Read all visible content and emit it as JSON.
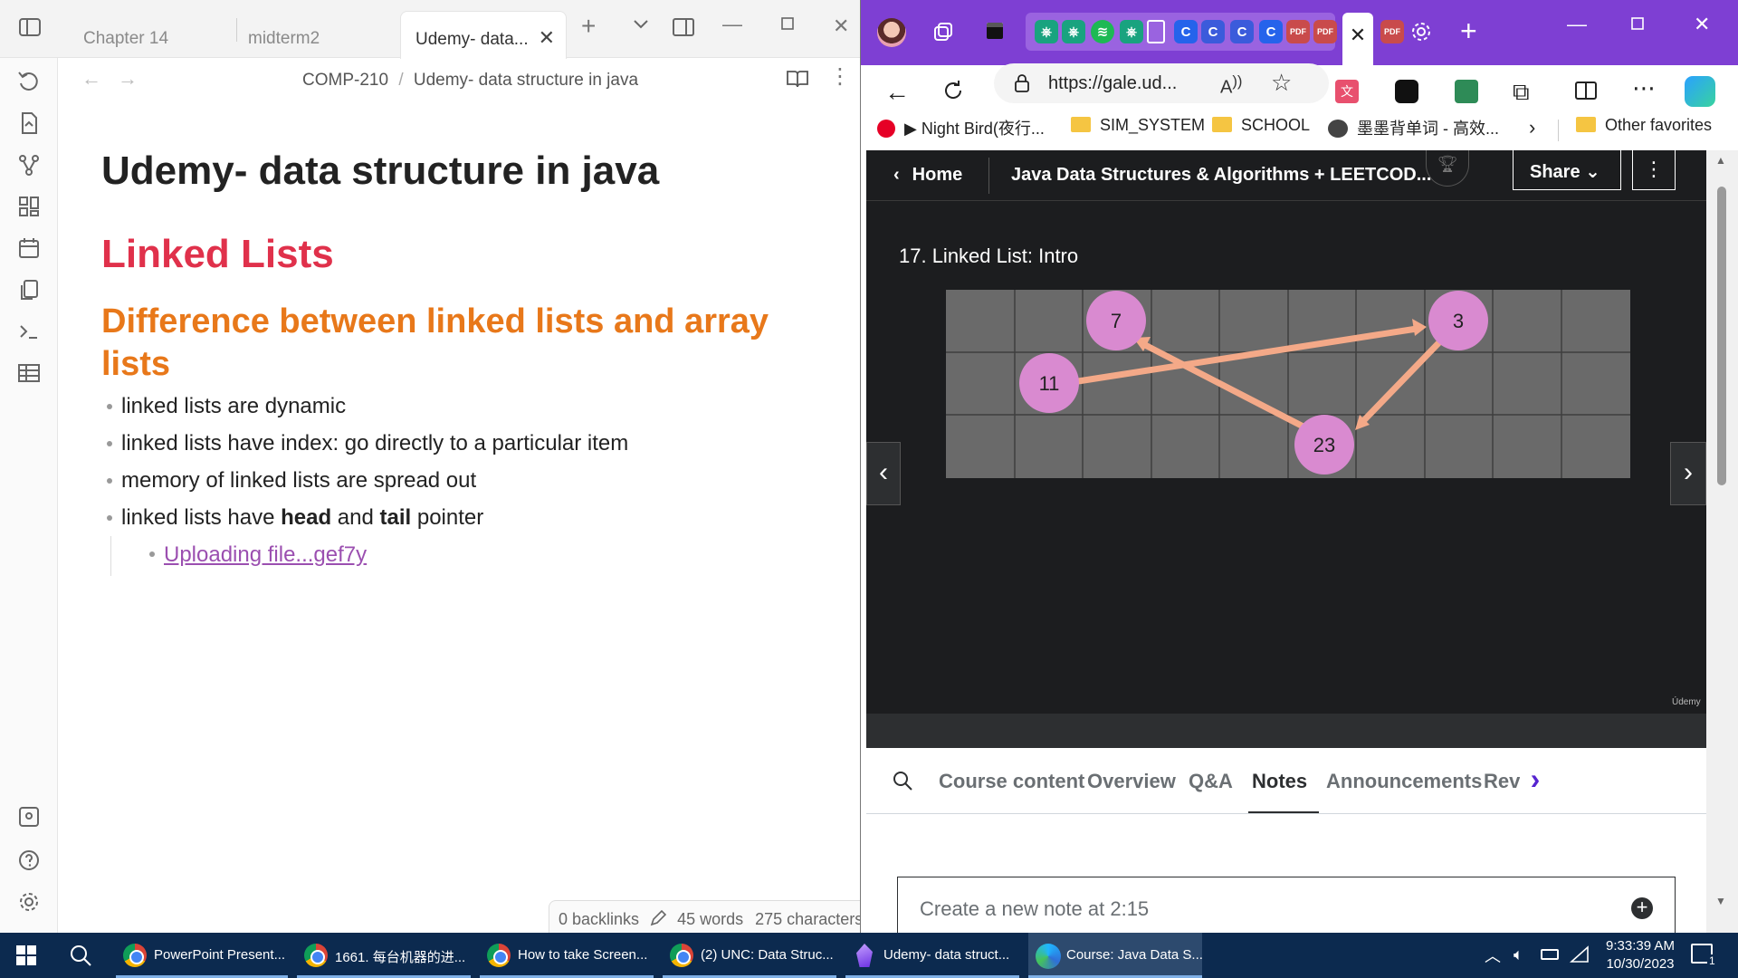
{
  "obsidian": {
    "tabs": [
      "Chapter 14",
      "midterm2",
      "Udemy- data..."
    ],
    "breadcrumb": {
      "folder": "COMP-210",
      "sep": "/",
      "note": "Udemy- data structure in java"
    },
    "title": "Udemy- data structure in java",
    "h1": "Linked Lists",
    "h2": "Difference between linked lists and array lists",
    "bullets": [
      {
        "text": "linked lists are dynamic"
      },
      {
        "text": "linked lists have index: go directly to a particular item"
      },
      {
        "text": "memory of linked lists are spread out"
      },
      {
        "pre": "linked lists have ",
        "b1": "head",
        "mid": " and ",
        "b2": "tail",
        "post": " pointer"
      }
    ],
    "sub_link": "Uploading file...gef7y",
    "status": {
      "backlinks": "0 backlinks",
      "words": "45 words",
      "chars": "275 characters"
    }
  },
  "edge": {
    "url": "https://gale.ud...",
    "favorites": {
      "night_bird": "▶ Night Bird(夜行...",
      "sim": "SIM_SYSTEM",
      "school": "SCHOOL",
      "vocab": "墨墨背单词 - 高效...",
      "other": "Other favorites"
    },
    "tab_letters": {
      "c": "C"
    }
  },
  "udemy": {
    "home": "Home",
    "course_title": "Java Data Structures & Algorithms + LEETCOD...",
    "share": "Share",
    "lecture": "17. Linked List: Intro",
    "watermark": "Údemy",
    "nodes": [
      {
        "label": "7"
      },
      {
        "label": "3"
      },
      {
        "label": "11"
      },
      {
        "label": "23"
      }
    ],
    "tabs": [
      "Course content",
      "Overview",
      "Q&A",
      "Notes",
      "Announcements",
      "Revi"
    ],
    "active_tab": "Notes",
    "note_placeholder": "Create a new note at 2:15"
  },
  "taskbar": {
    "items": [
      "PowerPoint Present...",
      "1661. 每台机器的进...",
      "How to take Screen...",
      "(2) UNC: Data Struc...",
      "Udemy- data struct...",
      "Course: Java Data S..."
    ],
    "time": "9:33:39 AM",
    "date": "10/30/2023",
    "notif_count": "1"
  }
}
